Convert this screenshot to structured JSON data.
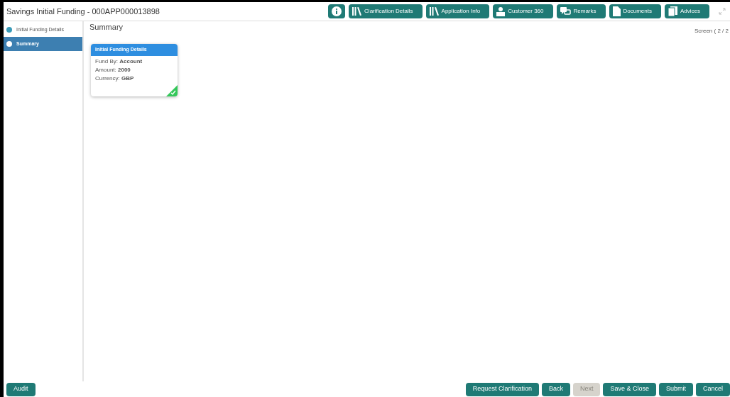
{
  "window": {
    "title": "Savings Initial Funding - 000APP000013898"
  },
  "toolbar": [
    {
      "kind": "info"
    },
    {
      "kind": "library",
      "label": "Clarification Details"
    },
    {
      "kind": "library",
      "label": "Application Info"
    },
    {
      "kind": "person",
      "label": "Customer 360"
    },
    {
      "kind": "chat",
      "label": "Remarks"
    },
    {
      "kind": "document",
      "label": "Documents"
    },
    {
      "kind": "pages",
      "label": "Advices"
    }
  ],
  "sidebar": {
    "items": [
      {
        "label": "Initial Funding Details",
        "selected": false
      },
      {
        "label": "Summary",
        "selected": true
      }
    ]
  },
  "main": {
    "heading": "Summary",
    "screen": "Screen ( 2 / 2",
    "cards": [
      {
        "title": "Initial Funding Details",
        "completed": true,
        "lines": [
          "Fund By: **Account**",
          "Amount: **2000**",
          "Currency: **GBP**"
        ]
      }
    ]
  },
  "footer": {
    "left": [
      {
        "label": "Audit",
        "disabled": false
      }
    ],
    "right": [
      {
        "label": "Request Clarification",
        "disabled": false
      },
      {
        "label": "Back",
        "disabled": false
      },
      {
        "label": "Next",
        "disabled": true
      },
      {
        "label": "Save & Close",
        "disabled": false
      },
      {
        "label": "Submit",
        "disabled": false
      },
      {
        "label": "Cancel",
        "disabled": false
      }
    ]
  }
}
